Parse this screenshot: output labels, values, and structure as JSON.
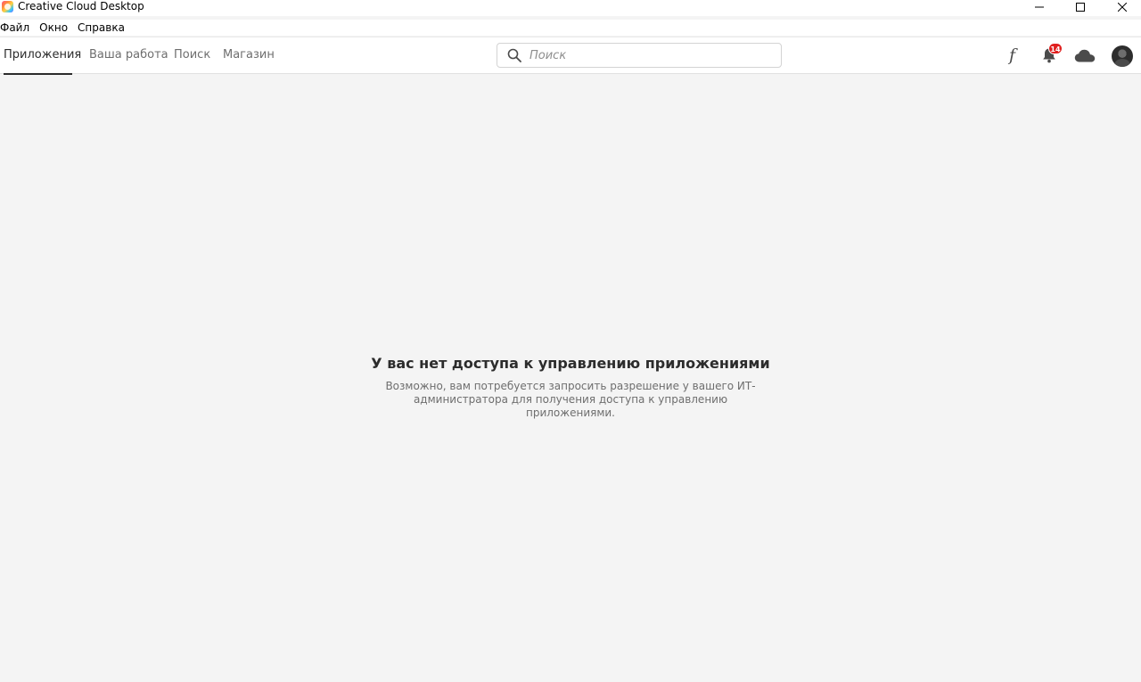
{
  "window": {
    "title": "Creative Cloud Desktop"
  },
  "menu": {
    "file": "Файл",
    "window": "Окно",
    "help": "Справка"
  },
  "nav": {
    "tabs": [
      {
        "label": "Приложения",
        "active": true
      },
      {
        "label": "Ваша работа",
        "active": false
      },
      {
        "label": "Поиск",
        "active": false
      },
      {
        "label": "Магазин",
        "active": false
      }
    ]
  },
  "search": {
    "placeholder": "Поиск",
    "value": ""
  },
  "header_icons": {
    "fonts_glyph": "f",
    "notifications_count": "14"
  },
  "content": {
    "title": "У вас нет доступа к управлению приложениями",
    "description": "Возможно, вам потребуется запросить разрешение у вашего ИТ-администратора для получения доступа к управлению приложениями."
  },
  "colors": {
    "background": "#f4f4f4",
    "active_tab_underline": "#2c2c2c",
    "badge": "#e0201f"
  }
}
